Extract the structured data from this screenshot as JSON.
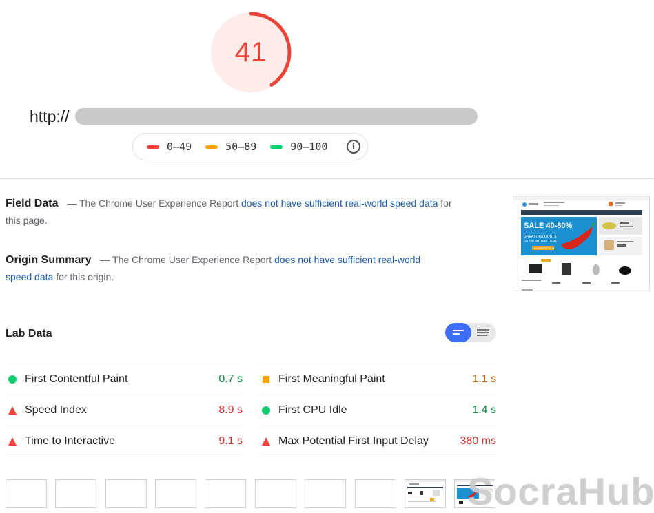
{
  "score": {
    "value": "41",
    "fraction": 0.41,
    "color": "#eb4335"
  },
  "url": {
    "prefix": "http://"
  },
  "legend": {
    "items": [
      {
        "label": "0–49",
        "color": "#f44336"
      },
      {
        "label": "50–89",
        "color": "#ffa400"
      },
      {
        "label": "90–100",
        "color": "#0cce6b"
      }
    ],
    "info_icon": "info-icon"
  },
  "field_data": {
    "title": "Field Data",
    "dash": "—",
    "text_before": "The Chrome User Experience Report",
    "link": "does not have sufficient real-world speed data",
    "text_after": "for this page."
  },
  "origin_summary": {
    "title": "Origin Summary",
    "dash": "—",
    "text_before": "The Chrome User Experience Report",
    "link": "does not have sufficient real-world speed data",
    "text_after": "for this origin."
  },
  "lab_data": {
    "title": "Lab Data",
    "left_metrics": [
      {
        "icon": "green-circle",
        "label": "First Contentful Paint",
        "value": "0.7 s",
        "status": "good"
      },
      {
        "icon": "red-triangle",
        "label": "Speed Index",
        "value": "8.9 s",
        "status": "bad"
      },
      {
        "icon": "red-triangle",
        "label": "Time to Interactive",
        "value": "9.1 s",
        "status": "bad"
      }
    ],
    "right_metrics": [
      {
        "icon": "orange-square",
        "label": "First Meaningful Paint",
        "value": "1.1 s",
        "status": "avg"
      },
      {
        "icon": "green-circle",
        "label": "First CPU Idle",
        "value": "1.4 s",
        "status": "good"
      },
      {
        "icon": "red-triangle",
        "label": "Max Potential First Input Delay",
        "value": "380 ms",
        "status": "bad"
      }
    ]
  },
  "thumbnail": {
    "sale_text": "SALE 40-80%",
    "sub1": "GREAT DISCOUNTS",
    "sub2": "ON THE HOTTEST ITEMS",
    "cta": "HURRY TO BUY"
  },
  "watermark": {
    "text_a": "Socra",
    "text_b": "Hub"
  },
  "colors": {
    "good": "#0cce6b",
    "avg": "#ffa400",
    "bad": "#f44336",
    "link": "#1a5bb5",
    "toggle_active": "#3d6ef5"
  }
}
